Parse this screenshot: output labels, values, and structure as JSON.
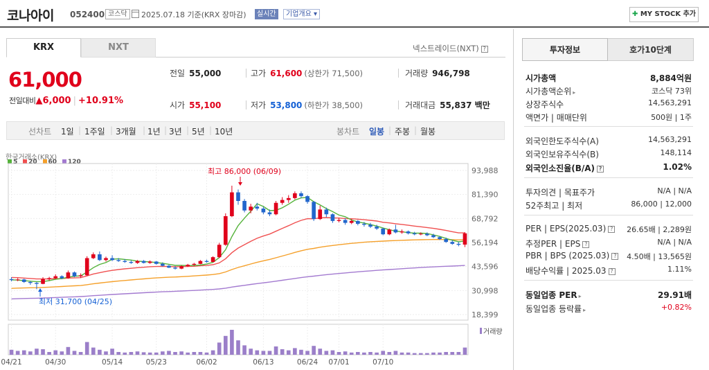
{
  "header": {
    "name": "코나아이",
    "code": "052400",
    "market": "코스닥",
    "date": "2025.07.18 기준(KRX 장마감)",
    "realtime": "실시간",
    "corp_info": "기업개요",
    "mystock": "MY STOCK 추가"
  },
  "tabs": {
    "krx": "KRX",
    "nxt": "NXT",
    "nxt_link": "넥스트레이드(NXT)"
  },
  "quote": {
    "price": "61,000",
    "change_label": "전일대비",
    "change": "6,000",
    "change_pct": "+10.91%",
    "prev_label": "전일",
    "prev": "55,000",
    "high_label": "고가",
    "high": "61,600",
    "upper_limit": "(상한가 71,500)",
    "volume_label": "거래량",
    "volume": "946,798",
    "open_label": "시가",
    "open": "55,100",
    "low_label": "저가",
    "low": "53,800",
    "lower_limit": "(하한가 38,500)",
    "amount_label": "거래대금",
    "amount": "55,837 백만"
  },
  "period_bar": {
    "line_label": "선차트",
    "line_opts": [
      "1일",
      "1주일",
      "3개월",
      "1년",
      "3년",
      "5년",
      "10년"
    ],
    "candle_label": "봉차트",
    "candle_opts": [
      "일봉",
      "주봉",
      "월봉"
    ],
    "selected": "일봉"
  },
  "chart_data": {
    "type": "candlestick",
    "source": "한국거래소(KRX)",
    "legend": [
      "5",
      "20",
      "60",
      "120"
    ],
    "legend_colors": [
      "#55b33b",
      "#f05050",
      "#f5a02a",
      "#a37ad0"
    ],
    "up_color": "#e0001b",
    "down_color": "#2266cc",
    "y_ticks": [
      "93,988",
      "81,390",
      "68,792",
      "56,194",
      "43,596",
      "30,998",
      "18,399"
    ],
    "ylim": [
      18399,
      93988
    ],
    "x_ticks": [
      "04/21",
      "04/30",
      "05/14",
      "05/23",
      "06/02",
      "06/13",
      "06/24",
      "07/01",
      "07/10"
    ],
    "high_note": "최고 86,000 (06/09)",
    "low_note": "최저 31,700 (04/25)",
    "volume_label": "거래량",
    "candles": [
      {
        "o": 37000,
        "c": 36500,
        "h": 38000,
        "l": 35800,
        "v": 18
      },
      {
        "o": 36500,
        "c": 36800,
        "h": 37500,
        "l": 35900,
        "v": 14
      },
      {
        "o": 36800,
        "c": 35500,
        "h": 37200,
        "l": 35000,
        "v": 16
      },
      {
        "o": 35500,
        "c": 35000,
        "h": 36000,
        "l": 34000,
        "v": 12
      },
      {
        "o": 35000,
        "c": 34500,
        "h": 35500,
        "l": 31700,
        "v": 22
      },
      {
        "o": 34500,
        "c": 37000,
        "h": 38000,
        "l": 34300,
        "v": 20
      },
      {
        "o": 37000,
        "c": 37500,
        "h": 38200,
        "l": 36200,
        "v": 10
      },
      {
        "o": 37500,
        "c": 38500,
        "h": 39500,
        "l": 37000,
        "v": 16
      },
      {
        "o": 38500,
        "c": 37500,
        "h": 39000,
        "l": 37000,
        "v": 12
      },
      {
        "o": 37500,
        "c": 40500,
        "h": 41500,
        "l": 37200,
        "v": 28
      },
      {
        "o": 40500,
        "c": 38500,
        "h": 41000,
        "l": 38000,
        "v": 14
      },
      {
        "o": 38500,
        "c": 39000,
        "h": 40000,
        "l": 37600,
        "v": 10
      },
      {
        "o": 39000,
        "c": 48000,
        "h": 49000,
        "l": 38800,
        "v": 46
      },
      {
        "o": 48000,
        "c": 50000,
        "h": 51000,
        "l": 47500,
        "v": 26
      },
      {
        "o": 50000,
        "c": 47000,
        "h": 51500,
        "l": 46500,
        "v": 18
      },
      {
        "o": 47000,
        "c": 48000,
        "h": 48800,
        "l": 46200,
        "v": 12
      },
      {
        "o": 48000,
        "c": 47000,
        "h": 49500,
        "l": 46500,
        "v": 22
      },
      {
        "o": 47000,
        "c": 46500,
        "h": 48000,
        "l": 46000,
        "v": 10
      },
      {
        "o": 46500,
        "c": 46000,
        "h": 47500,
        "l": 45500,
        "v": 8
      },
      {
        "o": 46000,
        "c": 45500,
        "h": 46800,
        "l": 45000,
        "v": 10
      },
      {
        "o": 45500,
        "c": 46500,
        "h": 47000,
        "l": 45000,
        "v": 12
      },
      {
        "o": 46500,
        "c": 45500,
        "h": 47000,
        "l": 45200,
        "v": 9
      },
      {
        "o": 45500,
        "c": 46200,
        "h": 46800,
        "l": 45000,
        "v": 8
      },
      {
        "o": 46200,
        "c": 45000,
        "h": 46500,
        "l": 44600,
        "v": 8
      },
      {
        "o": 45000,
        "c": 44000,
        "h": 45800,
        "l": 43600,
        "v": 12
      },
      {
        "o": 44000,
        "c": 43000,
        "h": 44500,
        "l": 42800,
        "v": 14
      },
      {
        "o": 43000,
        "c": 42500,
        "h": 43800,
        "l": 42000,
        "v": 10
      },
      {
        "o": 42500,
        "c": 43800,
        "h": 44200,
        "l": 42200,
        "v": 12
      },
      {
        "o": 43800,
        "c": 44500,
        "h": 45000,
        "l": 43400,
        "v": 8
      },
      {
        "o": 44500,
        "c": 45000,
        "h": 45500,
        "l": 44000,
        "v": 10
      },
      {
        "o": 45000,
        "c": 46500,
        "h": 47000,
        "l": 44800,
        "v": 10
      },
      {
        "o": 46500,
        "c": 46000,
        "h": 47200,
        "l": 45600,
        "v": 8
      },
      {
        "o": 46000,
        "c": 48500,
        "h": 49000,
        "l": 45800,
        "v": 16
      },
      {
        "o": 48500,
        "c": 55000,
        "h": 56000,
        "l": 48000,
        "v": 44
      },
      {
        "o": 55000,
        "c": 70000,
        "h": 71500,
        "l": 54500,
        "v": 68
      },
      {
        "o": 70000,
        "c": 82500,
        "h": 86000,
        "l": 69500,
        "v": 90
      },
      {
        "o": 82500,
        "c": 78000,
        "h": 84000,
        "l": 76000,
        "v": 52
      },
      {
        "o": 78000,
        "c": 73000,
        "h": 79000,
        "l": 72000,
        "v": 34
      },
      {
        "o": 73000,
        "c": 75000,
        "h": 76500,
        "l": 71500,
        "v": 22
      },
      {
        "o": 75000,
        "c": 74000,
        "h": 77000,
        "l": 73000,
        "v": 16
      },
      {
        "o": 74000,
        "c": 72000,
        "h": 75000,
        "l": 71000,
        "v": 14
      },
      {
        "o": 72000,
        "c": 71000,
        "h": 73500,
        "l": 70000,
        "v": 14
      },
      {
        "o": 71000,
        "c": 77000,
        "h": 78000,
        "l": 70500,
        "v": 30
      },
      {
        "o": 77000,
        "c": 78500,
        "h": 80000,
        "l": 76000,
        "v": 20
      },
      {
        "o": 78500,
        "c": 79500,
        "h": 81000,
        "l": 77000,
        "v": 16
      },
      {
        "o": 79500,
        "c": 82000,
        "h": 83000,
        "l": 78800,
        "v": 24
      },
      {
        "o": 82000,
        "c": 80500,
        "h": 83000,
        "l": 79500,
        "v": 18
      },
      {
        "o": 80500,
        "c": 77500,
        "h": 81000,
        "l": 76500,
        "v": 14
      },
      {
        "o": 77500,
        "c": 68500,
        "h": 78000,
        "l": 67500,
        "v": 32
      },
      {
        "o": 68500,
        "c": 73500,
        "h": 75500,
        "l": 68000,
        "v": 22
      },
      {
        "o": 73500,
        "c": 71000,
        "h": 74500,
        "l": 69500,
        "v": 14
      },
      {
        "o": 71000,
        "c": 67500,
        "h": 71500,
        "l": 66500,
        "v": 16
      },
      {
        "o": 67500,
        "c": 68000,
        "h": 69000,
        "l": 66800,
        "v": 10
      },
      {
        "o": 68000,
        "c": 66500,
        "h": 69000,
        "l": 65500,
        "v": 12
      },
      {
        "o": 66500,
        "c": 67500,
        "h": 68500,
        "l": 65800,
        "v": 8
      },
      {
        "o": 67500,
        "c": 66000,
        "h": 68000,
        "l": 65200,
        "v": 10
      },
      {
        "o": 66000,
        "c": 65500,
        "h": 67000,
        "l": 64500,
        "v": 8
      },
      {
        "o": 65500,
        "c": 64500,
        "h": 66500,
        "l": 63800,
        "v": 10
      },
      {
        "o": 64500,
        "c": 63500,
        "h": 65500,
        "l": 62800,
        "v": 8
      },
      {
        "o": 63500,
        "c": 60500,
        "h": 64000,
        "l": 60000,
        "v": 14
      },
      {
        "o": 60500,
        "c": 63000,
        "h": 63500,
        "l": 60000,
        "v": 10
      },
      {
        "o": 63000,
        "c": 61500,
        "h": 65500,
        "l": 61000,
        "v": 14
      },
      {
        "o": 61500,
        "c": 62000,
        "h": 63000,
        "l": 60800,
        "v": 8
      },
      {
        "o": 62000,
        "c": 61000,
        "h": 62500,
        "l": 60400,
        "v": 8
      },
      {
        "o": 61000,
        "c": 60500,
        "h": 61800,
        "l": 60000,
        "v": 6
      },
      {
        "o": 60500,
        "c": 60800,
        "h": 61500,
        "l": 60000,
        "v": 6
      },
      {
        "o": 60800,
        "c": 60000,
        "h": 61500,
        "l": 59500,
        "v": 6
      },
      {
        "o": 60000,
        "c": 59000,
        "h": 60800,
        "l": 58500,
        "v": 8
      },
      {
        "o": 59000,
        "c": 58000,
        "h": 59500,
        "l": 57500,
        "v": 8
      },
      {
        "o": 58000,
        "c": 56500,
        "h": 58800,
        "l": 56000,
        "v": 10
      },
      {
        "o": 56500,
        "c": 55500,
        "h": 57500,
        "l": 55000,
        "v": 10
      },
      {
        "o": 55500,
        "c": 55000,
        "h": 56500,
        "l": 54200,
        "v": 10
      },
      {
        "o": 55100,
        "c": 61000,
        "h": 61600,
        "l": 53800,
        "v": 26
      }
    ],
    "ma5": [
      36600,
      36500,
      36200,
      35900,
      35700,
      35700,
      36200,
      36900,
      37300,
      38000,
      38500,
      38700,
      40700,
      43000,
      44700,
      45700,
      47400,
      47700,
      47300,
      47000,
      46400,
      46200,
      46000,
      45700,
      45300,
      44800,
      44200,
      44200,
      44100,
      44100,
      44400,
      44900,
      45800,
      48300,
      52400,
      59300,
      65100,
      69000,
      72600,
      76500,
      75100,
      72900,
      73100,
      74400,
      76300,
      78400,
      79600,
      79800,
      77600,
      75900,
      74000,
      72400,
      70600,
      69700,
      68000,
      67000,
      66400,
      65600,
      64800,
      63800,
      62900,
      62200,
      61800,
      61400,
      61100,
      61100,
      60900,
      60200,
      59400,
      58300,
      57400,
      56600,
      57000
    ],
    "ma20": [],
    "ma60": [],
    "ma120": []
  },
  "right_panel": {
    "tab_invest": "투자정보",
    "tab_hoga": "호가10단계",
    "rows": [
      {
        "k": "시가총액",
        "v": "8,884억원",
        "bold": true
      },
      {
        "k": "시가총액순위",
        "v": "코스닥 73위",
        "tri": true
      },
      {
        "k": "상장주식수",
        "v": "14,563,291"
      },
      {
        "k": "액면가 | 매매단위",
        "v": "500원 | 1주"
      },
      {
        "k": "외국인한도주식수(A)",
        "v": "14,563,291"
      },
      {
        "k": "외국인보유주식수(B)",
        "v": "148,114"
      },
      {
        "k": "외국인소진율(B/A)",
        "v": "1.02%",
        "bold": true,
        "q": true
      },
      {
        "k": "투자의견 | 목표주가",
        "v": "N/A | N/A"
      },
      {
        "k": "52주최고 | 최저",
        "v": "86,000 | 12,000"
      },
      {
        "k": "PER | EPS(2025.03)",
        "v": "26.65배 | 2,289원",
        "q": true
      },
      {
        "k": "추정PER | EPS",
        "v": "N/A | N/A",
        "q": true
      },
      {
        "k": "PBR | BPS (2025.03)",
        "v": "4.50배 | 13,565원",
        "q": true
      },
      {
        "k": "배당수익률 | 2025.03",
        "v": "1.11%",
        "q": true
      },
      {
        "k": "동일업종 PER",
        "v": "29.91배",
        "bold": true,
        "tri": true
      },
      {
        "k": "동일업종 등락률",
        "v": "+0.82%",
        "red": true,
        "tri": true
      }
    ]
  }
}
